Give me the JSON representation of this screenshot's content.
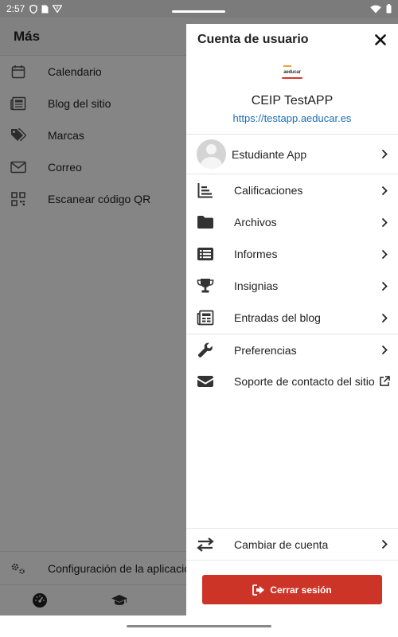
{
  "status_bar": {
    "time": "2:57",
    "icons": [
      "shield-icon",
      "sim-icon",
      "vpn-icon"
    ],
    "right_icons": [
      "wifi-icon",
      "battery-icon"
    ]
  },
  "background_app": {
    "title": "Más",
    "items": [
      {
        "label": "Calendario",
        "icon": "calendar-icon"
      },
      {
        "label": "Blog del sitio",
        "icon": "newspaper-icon"
      },
      {
        "label": "Marcas",
        "icon": "tags-icon"
      },
      {
        "label": "Correo",
        "icon": "mail-icon"
      },
      {
        "label": "Escanear código QR",
        "icon": "qrcode-icon"
      }
    ],
    "config_label": "Configuración de la aplicación",
    "tabs": [
      "dashboard-icon",
      "graduation-cap-icon"
    ]
  },
  "drawer": {
    "title": "Cuenta de usuario",
    "logo_text": "aeducar",
    "site_name": "CEIP TestAPP",
    "site_url": "https://testapp.aeducar.es",
    "user_name": "Estudiante App",
    "menu": [
      {
        "label": "Calificaciones",
        "icon": "grades-chart-icon"
      },
      {
        "label": "Archivos",
        "icon": "folder-icon"
      },
      {
        "label": "Informes",
        "icon": "list-report-icon"
      },
      {
        "label": "Insignias",
        "icon": "trophy-icon"
      },
      {
        "label": "Entradas del blog",
        "icon": "newspaper-icon"
      }
    ],
    "menu2": [
      {
        "label": "Preferencias",
        "icon": "wrench-icon"
      },
      {
        "label": "Soporte de contacto del sitio",
        "icon": "envelope-icon"
      }
    ],
    "switch_label": "Cambiar de cuenta",
    "logout_label": "Cerrar sesión"
  },
  "colors": {
    "accent_link": "#1a6fb5",
    "logout_button": "#cb3426",
    "scrim": "rgba(0,0,0,0.48)"
  }
}
